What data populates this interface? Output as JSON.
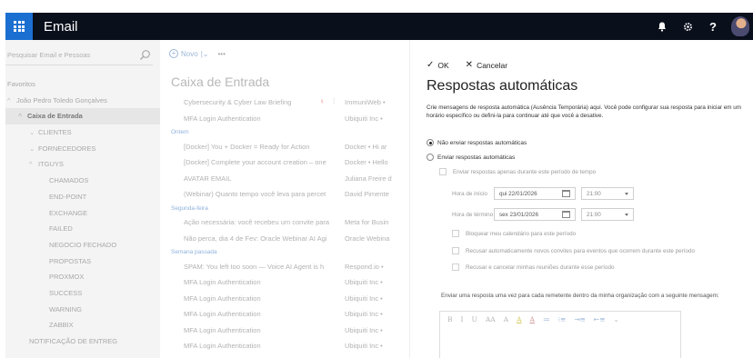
{
  "app": {
    "title": "Email"
  },
  "topbar": {
    "bell": "bell-icon",
    "gear": "gear-icon",
    "help": "?"
  },
  "search": {
    "placeholder": "Pesquisar Email e Pessoas"
  },
  "sidebar": {
    "items": [
      {
        "label": "Favoritos",
        "caret": "",
        "indent": 0
      },
      {
        "label": "João Pedro Toledo Gonçalves",
        "caret": "^",
        "indent": 0
      },
      {
        "label": "Caixa de Entrada",
        "caret": "^",
        "indent": 1,
        "selected": true
      },
      {
        "label": "CLIENTES",
        "caret": "v",
        "indent": 2
      },
      {
        "label": "FORNECEDORES",
        "caret": "v",
        "indent": 2
      },
      {
        "label": "ITGUYS",
        "caret": "^",
        "indent": 2
      },
      {
        "label": "CHAMADOS",
        "caret": "",
        "indent": 3
      },
      {
        "label": "END-POINT",
        "caret": "",
        "indent": 3
      },
      {
        "label": "EXCHANGE",
        "caret": "",
        "indent": 3
      },
      {
        "label": "FAILED",
        "caret": "",
        "indent": 3
      },
      {
        "label": "NEGOCIO FECHADO",
        "caret": "",
        "indent": 3
      },
      {
        "label": "PROPOSTAS",
        "caret": "",
        "indent": 3
      },
      {
        "label": "PROXMOX",
        "caret": "",
        "indent": 3
      },
      {
        "label": "SUCCESS",
        "caret": "",
        "indent": 3
      },
      {
        "label": "WARNING",
        "caret": "",
        "indent": 3
      },
      {
        "label": "ZABBIX",
        "caret": "",
        "indent": 3
      },
      {
        "label": "NOTIFICAÇÃO DE ENTREG",
        "caret": "",
        "indent": 2
      }
    ]
  },
  "maillist": {
    "new_label": "Novo",
    "more": "•••",
    "title": "Caixa de Entrada",
    "rows": [
      {
        "type": "mail",
        "subject": "Cybersecurity & Cyber Law Briefing",
        "sender": "ImmuniWeb • ",
        "flag": true
      },
      {
        "type": "mail",
        "subject": "MFA Login Authentication",
        "sender": "Ubiquiti Inc • "
      },
      {
        "type": "group",
        "label": "Ontem"
      },
      {
        "type": "mail",
        "subject": "[Docker] You + Docker = Ready for Action",
        "sender": "Docker • Hi ar"
      },
      {
        "type": "mail",
        "subject": "[Docker] Complete your account creation – one",
        "sender": "Docker • Hello"
      },
      {
        "type": "mail",
        "subject": "AVATAR EMAIL",
        "sender": "Juliana Freire d"
      },
      {
        "type": "mail",
        "subject": "(Webinar) Quanto tempo você leva para percet",
        "sender": "David Pimente"
      },
      {
        "type": "group",
        "label": "Segunda-feira"
      },
      {
        "type": "mail",
        "subject": "Ação necessária: você recebeu um convite para",
        "sender": "Meta for Busin"
      },
      {
        "type": "mail",
        "subject": "Não perca, dia 4 de Fev: Oracle Webinar AI Agi",
        "sender": "Oracle Webina"
      },
      {
        "type": "group",
        "label": "Semana passada"
      },
      {
        "type": "mail",
        "subject": "SPAM: You left too soon — Voice AI Agent is h",
        "sender": "Respond.io • "
      },
      {
        "type": "mail",
        "subject": "MFA Login Authentication",
        "sender": "Ubiquiti Inc • "
      },
      {
        "type": "mail",
        "subject": "MFA Login Authentication",
        "sender": "Ubiquiti Inc • "
      },
      {
        "type": "mail",
        "subject": "MFA Login Authentication",
        "sender": "Ubiquiti Inc • "
      },
      {
        "type": "mail",
        "subject": "MFA Login Authentication",
        "sender": "Ubiquiti Inc • "
      },
      {
        "type": "mail",
        "subject": "MFA Login Authentication",
        "sender": "Ubiquiti Inc • "
      }
    ]
  },
  "panel": {
    "ok_label": "OK",
    "cancel_label": "Cancelar",
    "title": "Respostas automáticas",
    "description": "Crie mensagens de resposta automática (Ausência Temporária) aqui. Você pode configurar sua resposta para iniciar em um horário específico ou defini-la para continuar até que você a desative.",
    "radio_off": "Não enviar respostas automáticas",
    "radio_on": "Enviar respostas automáticas",
    "only_period": "Enviar respostas apenas durante este período de tempo",
    "start_label": "Hora de início",
    "start_date": "qui 22/01/2026",
    "start_time": "21:00",
    "end_label": "Hora de término",
    "end_date": "sex 23/01/2026",
    "end_time": "21:00",
    "block_calendar": "Bloquear meu calendário para este período",
    "decline_new": "Recusar automaticamente novos convites para eventos que ocorrem durante este período",
    "decline_cancel": "Recusar e cancelar minhas reuniões durante esse período",
    "reply_text": "Enviar uma resposta uma vez para cada remetente dentro da minha organização com a seguinte mensagem:",
    "editor_tools": [
      "B",
      "I",
      "U",
      "AA",
      "A",
      "A",
      "A",
      "≔",
      "⁝≡",
      "⇥≡",
      "⇤≡",
      "⌄"
    ]
  }
}
